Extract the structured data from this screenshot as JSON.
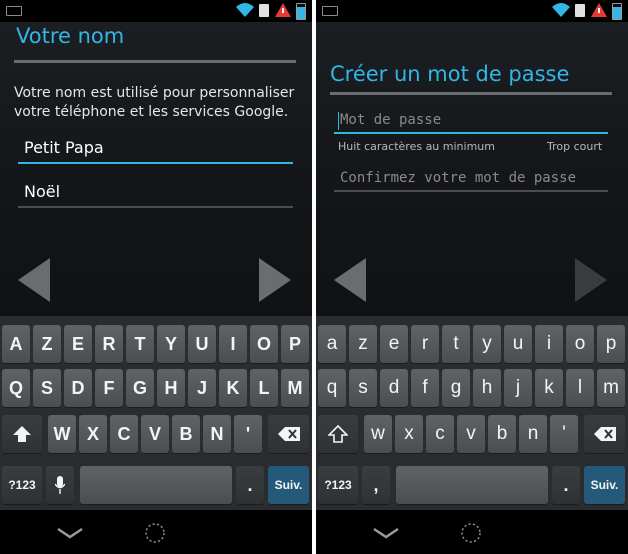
{
  "colors": {
    "accent": "#33b5e5",
    "action_key": "#25597a",
    "keyboard_bg": "#2a2c2f"
  },
  "left_screen": {
    "title": "Votre nom",
    "description_line1": "Votre nom est utilisé pour personnaliser",
    "description_line2": "votre téléphone et les services Google.",
    "first_name_value": "Petit Papa",
    "last_name_value": "Noël",
    "keyboard": {
      "row1": [
        "A",
        "Z",
        "E",
        "R",
        "T",
        "Y",
        "U",
        "I",
        "O",
        "P"
      ],
      "row2": [
        "Q",
        "S",
        "D",
        "F",
        "G",
        "H",
        "J",
        "K",
        "L",
        "M"
      ],
      "row3": [
        "W",
        "X",
        "C",
        "V",
        "B",
        "N",
        "'"
      ],
      "symbols_key": "?123",
      "period_key": ".",
      "action_key": "Suiv."
    }
  },
  "right_screen": {
    "title": "Créer un mot de passe",
    "password_placeholder": "Mot de passe",
    "password_hint": "Huit caractères au minimum",
    "password_strength": "Trop court",
    "confirm_placeholder": "Confirmez votre mot de passe",
    "keyboard": {
      "row1": [
        "a",
        "z",
        "e",
        "r",
        "t",
        "y",
        "u",
        "i",
        "o",
        "p"
      ],
      "row2": [
        "q",
        "s",
        "d",
        "f",
        "g",
        "h",
        "j",
        "k",
        "l",
        "m"
      ],
      "row3": [
        "w",
        "x",
        "c",
        "v",
        "b",
        "n",
        "'"
      ],
      "symbols_key": "?123",
      "comma_key": ",",
      "period_key": ".",
      "action_key": "Suiv."
    }
  },
  "icons": {
    "status_notification": "notification-icon",
    "status_wifi": "wifi-icon",
    "status_sd": "sd-card-icon",
    "status_alert": "alert-icon",
    "status_battery": "battery-icon",
    "nav_prev": "left-arrow-icon",
    "nav_next": "right-arrow-icon",
    "shift": "shift-icon",
    "delete": "backspace-icon",
    "mic": "microphone-icon",
    "sys_back": "back-chevron-icon",
    "sys_home": "home-circle-icon"
  }
}
